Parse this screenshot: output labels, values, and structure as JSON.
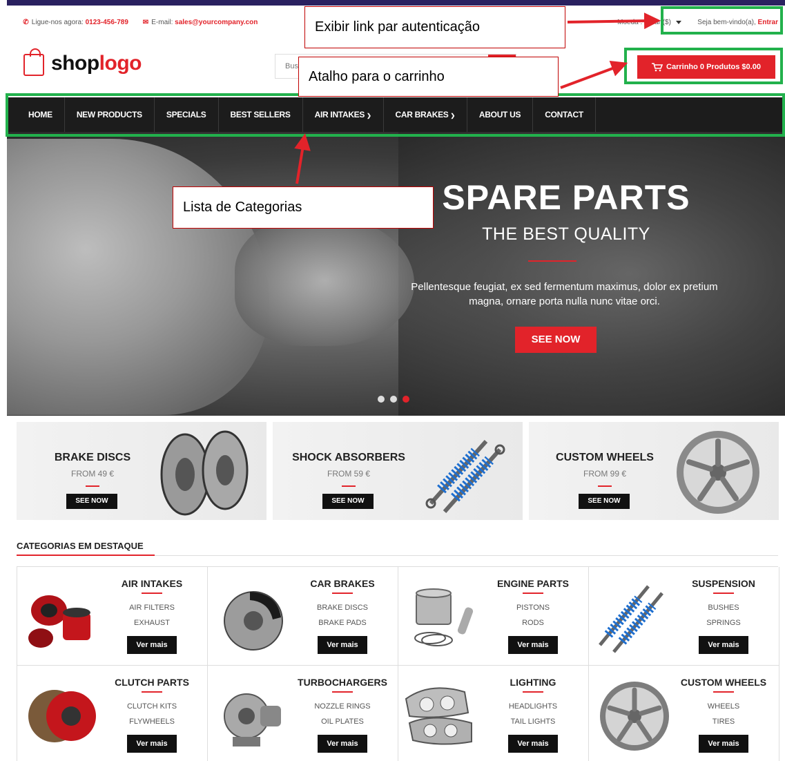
{
  "topbar": {
    "phone_label": "Ligue-nos agora:",
    "phone": "0123-456-789",
    "email_label": "E-mail:",
    "email": "sales@yourcompany.con",
    "currency": "Moeda : Dólar ($)",
    "welcome": "Seja bem-vindo(a),",
    "login": "Entrar"
  },
  "header": {
    "logo_part1": "shop",
    "logo_part2": "logo",
    "search_placeholder": "Buscar",
    "cart_label": "Carrinho 0 Produtos $0.00"
  },
  "nav": {
    "items": [
      {
        "label": "HOME",
        "dropdown": false
      },
      {
        "label": "NEW PRODUCTS",
        "dropdown": false
      },
      {
        "label": "SPECIALS",
        "dropdown": false
      },
      {
        "label": "BEST SELLERS",
        "dropdown": false
      },
      {
        "label": "AIR INTAKES",
        "dropdown": true
      },
      {
        "label": "CAR BRAKES",
        "dropdown": true
      },
      {
        "label": "ABOUT US",
        "dropdown": false
      },
      {
        "label": "CONTACT",
        "dropdown": false
      }
    ]
  },
  "hero": {
    "title": "SPARE PARTS",
    "subtitle": "THE BEST QUALITY",
    "description": "Pellentesque feugiat, ex sed fermentum maximus, dolor ex pretium magna, ornare porta nulla nunc vitae orci.",
    "cta": "SEE NOW",
    "slides": 3,
    "active_slide": 3
  },
  "banners": [
    {
      "title": "BRAKE DISCS",
      "price": "FROM 49 €",
      "button": "SEE NOW"
    },
    {
      "title": "SHOCK ABSORBERS",
      "price": "FROM 59 €",
      "button": "SEE NOW"
    },
    {
      "title": "CUSTOM WHEELS",
      "price": "FROM 99 €",
      "button": "SEE NOW"
    }
  ],
  "featured": {
    "title": "CATEGORIAS EM DESTAQUE",
    "categories": [
      {
        "name": "AIR INTAKES",
        "sub1": "AIR FILTERS",
        "sub2": "EXHAUST",
        "button": "Ver mais"
      },
      {
        "name": "CAR BRAKES",
        "sub1": "BRAKE DISCS",
        "sub2": "BRAKE PADS",
        "button": "Ver mais"
      },
      {
        "name": "ENGINE PARTS",
        "sub1": "PISTONS",
        "sub2": "RODS",
        "button": "Ver mais"
      },
      {
        "name": "SUSPENSION",
        "sub1": "BUSHES",
        "sub2": "SPRINGS",
        "button": "Ver mais"
      },
      {
        "name": "CLUTCH PARTS",
        "sub1": "CLUTCH KITS",
        "sub2": "FLYWHEELS",
        "button": "Ver mais"
      },
      {
        "name": "TURBOCHARGERS",
        "sub1": "NOZZLE RINGS",
        "sub2": "OIL PLATES",
        "button": "Ver mais"
      },
      {
        "name": "LIGHTING",
        "sub1": "HEADLIGHTS",
        "sub2": "TAIL LIGHTS",
        "button": "Ver mais"
      },
      {
        "name": "CUSTOM WHEELS",
        "sub1": "WHEELS",
        "sub2": "TIRES",
        "button": "Ver mais"
      }
    ]
  },
  "annotations": {
    "auth": "Exibir link par autenticação",
    "cart": "Atalho para o carrinho",
    "categories": "Lista de Categorias"
  },
  "colors": {
    "accent": "#e2232a",
    "nav_bg": "#1c1c1c",
    "annotation_highlight": "#22b14c",
    "annotation_border": "#c00000"
  }
}
